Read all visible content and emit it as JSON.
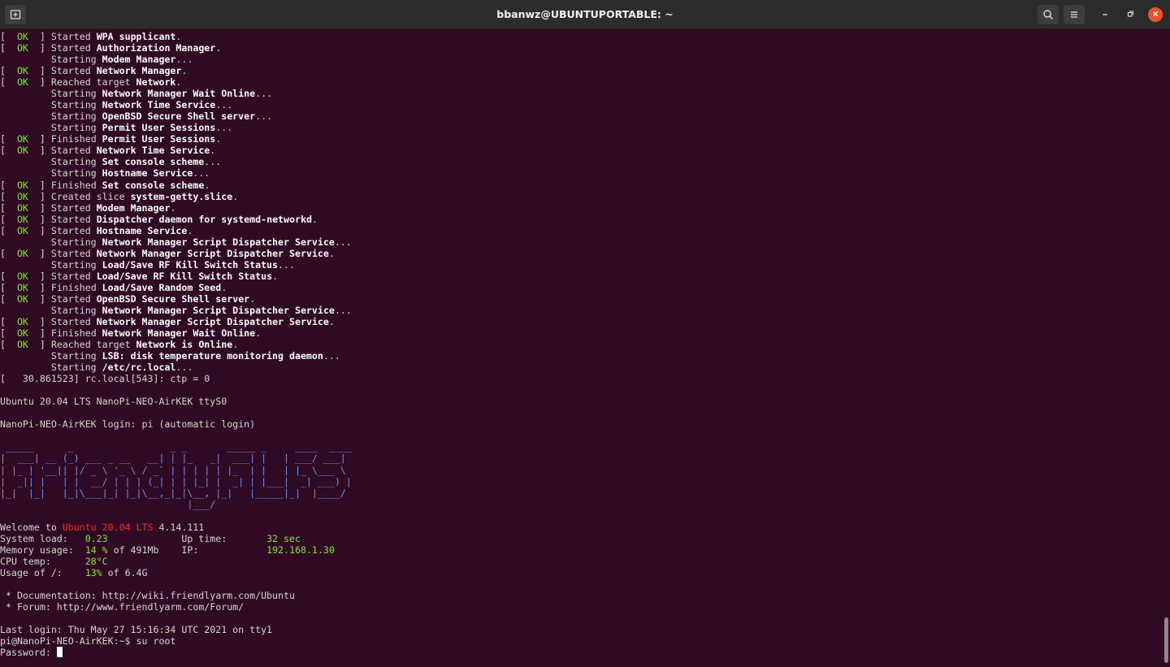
{
  "window": {
    "title": "bbanwz@UBUNTUPORTABLE: ~",
    "icons": {
      "new_tab": "new-tab-icon",
      "search": "search-icon",
      "menu": "hamburger-menu-icon",
      "minimize": "minimize-icon",
      "maximize": "maximize-icon",
      "close": "close-icon"
    },
    "colors": {
      "terminal_bg": "#300a24",
      "titlebar_bg": "#2c2c2c",
      "ok_green": "#8ae234",
      "highlight_red": "#ef2929",
      "logo_blue": "#7a8fe0",
      "close_orange": "#e9542b"
    }
  },
  "terminal": {
    "lines": [
      [
        {
          "t": "[  "
        },
        {
          "t": "OK",
          "c": "ok"
        },
        {
          "t": "  ] Started "
        },
        {
          "t": "WPA supplicant",
          "c": "b"
        },
        {
          "t": "."
        }
      ],
      [
        {
          "t": "[  "
        },
        {
          "t": "OK",
          "c": "ok"
        },
        {
          "t": "  ] Started "
        },
        {
          "t": "Authorization Manager",
          "c": "b"
        },
        {
          "t": "."
        }
      ],
      [
        {
          "t": "         Starting "
        },
        {
          "t": "Modem Manager",
          "c": "b"
        },
        {
          "t": "..."
        }
      ],
      [
        {
          "t": "[  "
        },
        {
          "t": "OK",
          "c": "ok"
        },
        {
          "t": "  ] Started "
        },
        {
          "t": "Network Manager",
          "c": "b"
        },
        {
          "t": "."
        }
      ],
      [
        {
          "t": "[  "
        },
        {
          "t": "OK",
          "c": "ok"
        },
        {
          "t": "  ] Reached target "
        },
        {
          "t": "Network",
          "c": "b"
        },
        {
          "t": "."
        }
      ],
      [
        {
          "t": "         Starting "
        },
        {
          "t": "Network Manager Wait Online",
          "c": "b"
        },
        {
          "t": "..."
        }
      ],
      [
        {
          "t": "         Starting "
        },
        {
          "t": "Network Time Service",
          "c": "b"
        },
        {
          "t": "..."
        }
      ],
      [
        {
          "t": "         Starting "
        },
        {
          "t": "OpenBSD Secure Shell server",
          "c": "b"
        },
        {
          "t": "..."
        }
      ],
      [
        {
          "t": "         Starting "
        },
        {
          "t": "Permit User Sessions",
          "c": "b"
        },
        {
          "t": "..."
        }
      ],
      [
        {
          "t": "[  "
        },
        {
          "t": "OK",
          "c": "ok"
        },
        {
          "t": "  ] Finished "
        },
        {
          "t": "Permit User Sessions",
          "c": "b"
        },
        {
          "t": "."
        }
      ],
      [
        {
          "t": "[  "
        },
        {
          "t": "OK",
          "c": "ok"
        },
        {
          "t": "  ] Started "
        },
        {
          "t": "Network Time Service",
          "c": "b"
        },
        {
          "t": "."
        }
      ],
      [
        {
          "t": "         Starting "
        },
        {
          "t": "Set console scheme",
          "c": "b"
        },
        {
          "t": "..."
        }
      ],
      [
        {
          "t": "         Starting "
        },
        {
          "t": "Hostname Service",
          "c": "b"
        },
        {
          "t": "..."
        }
      ],
      [
        {
          "t": "[  "
        },
        {
          "t": "OK",
          "c": "ok"
        },
        {
          "t": "  ] Finished "
        },
        {
          "t": "Set console scheme",
          "c": "b"
        },
        {
          "t": "."
        }
      ],
      [
        {
          "t": "[  "
        },
        {
          "t": "OK",
          "c": "ok"
        },
        {
          "t": "  ] Created slice "
        },
        {
          "t": "system-getty.slice",
          "c": "b"
        },
        {
          "t": "."
        }
      ],
      [
        {
          "t": "[  "
        },
        {
          "t": "OK",
          "c": "ok"
        },
        {
          "t": "  ] Started "
        },
        {
          "t": "Modem Manager",
          "c": "b"
        },
        {
          "t": "."
        }
      ],
      [
        {
          "t": "[  "
        },
        {
          "t": "OK",
          "c": "ok"
        },
        {
          "t": "  ] Started "
        },
        {
          "t": "Dispatcher daemon for systemd-networkd",
          "c": "b"
        },
        {
          "t": "."
        }
      ],
      [
        {
          "t": "[  "
        },
        {
          "t": "OK",
          "c": "ok"
        },
        {
          "t": "  ] Started "
        },
        {
          "t": "Hostname Service",
          "c": "b"
        },
        {
          "t": "."
        }
      ],
      [
        {
          "t": "         Starting "
        },
        {
          "t": "Network Manager Script Dispatcher Service",
          "c": "b"
        },
        {
          "t": "..."
        }
      ],
      [
        {
          "t": "[  "
        },
        {
          "t": "OK",
          "c": "ok"
        },
        {
          "t": "  ] Started "
        },
        {
          "t": "Network Manager Script Dispatcher Service",
          "c": "b"
        },
        {
          "t": "."
        }
      ],
      [
        {
          "t": "         Starting "
        },
        {
          "t": "Load/Save RF Kill Switch Status",
          "c": "b"
        },
        {
          "t": "..."
        }
      ],
      [
        {
          "t": "[  "
        },
        {
          "t": "OK",
          "c": "ok"
        },
        {
          "t": "  ] Started "
        },
        {
          "t": "Load/Save RF Kill Switch Status",
          "c": "b"
        },
        {
          "t": "."
        }
      ],
      [
        {
          "t": "[  "
        },
        {
          "t": "OK",
          "c": "ok"
        },
        {
          "t": "  ] Finished "
        },
        {
          "t": "Load/Save Random Seed",
          "c": "b"
        },
        {
          "t": "."
        }
      ],
      [
        {
          "t": "[  "
        },
        {
          "t": "OK",
          "c": "ok"
        },
        {
          "t": "  ] Started "
        },
        {
          "t": "OpenBSD Secure Shell server",
          "c": "b"
        },
        {
          "t": "."
        }
      ],
      [
        {
          "t": "         Starting "
        },
        {
          "t": "Network Manager Script Dispatcher Service",
          "c": "b"
        },
        {
          "t": "..."
        }
      ],
      [
        {
          "t": "[  "
        },
        {
          "t": "OK",
          "c": "ok"
        },
        {
          "t": "  ] Started "
        },
        {
          "t": "Network Manager Script Dispatcher Service",
          "c": "b"
        },
        {
          "t": "."
        }
      ],
      [
        {
          "t": "[  "
        },
        {
          "t": "OK",
          "c": "ok"
        },
        {
          "t": "  ] Finished "
        },
        {
          "t": "Network Manager Wait Online",
          "c": "b"
        },
        {
          "t": "."
        }
      ],
      [
        {
          "t": "[  "
        },
        {
          "t": "OK",
          "c": "ok"
        },
        {
          "t": "  ] Reached target "
        },
        {
          "t": "Network is Online",
          "c": "b"
        },
        {
          "t": "."
        }
      ],
      [
        {
          "t": "         Starting "
        },
        {
          "t": "LSB: disk temperature monitoring daemon",
          "c": "b"
        },
        {
          "t": "..."
        }
      ],
      [
        {
          "t": "         Starting "
        },
        {
          "t": "/etc/rc.local",
          "c": "b"
        },
        {
          "t": "..."
        }
      ],
      [
        {
          "t": "[   30.861523] rc.local[543]: ctp = 0"
        }
      ],
      [],
      [
        {
          "t": "Ubuntu 20.04 LTS NanoPi-NEO-AirKEK ttyS0"
        }
      ],
      [],
      [
        {
          "t": "NanoPi-NEO-AirKEK login: pi (automatic login)"
        }
      ],
      [],
      [
        {
          "t": " _____      _                 _ _       _____ _     ____  ____ ",
          "c": "logo"
        }
      ],
      [
        {
          "t": "|  ___| __ (_) ___ _ __   __| | |_   _|  ___| |   | ___/ ___|",
          "c": "logo"
        }
      ],
      [
        {
          "t": "| |_ | '__|| |/ _ \\ '_ \\ / _` | | | | | |_  | |   | |_ \\___ \\",
          "c": "logo"
        }
      ],
      [
        {
          "t": "|  _|| |   | |  __/ | | | (_| | | |_| |  _| | |___|  _| ___) |",
          "c": "logo"
        }
      ],
      [
        {
          "t": "|_|  |_|   |_|\\___|_| |_|\\__,_|_|\\__, |_|   |_____|_|  |____/",
          "c": "logo"
        }
      ],
      [
        {
          "t": "                                 |___/",
          "c": "logo"
        }
      ],
      [],
      [
        {
          "t": "Welcome to "
        },
        {
          "t": "Ubuntu 20.04 LTS",
          "c": "red"
        },
        {
          "t": " 4.14.111"
        }
      ],
      [
        {
          "t": "System load:   "
        },
        {
          "t": "0.23",
          "c": "grn"
        },
        {
          "t": "             Up time:       "
        },
        {
          "t": "32 sec",
          "c": "grn"
        }
      ],
      [
        {
          "t": "Memory usage:  "
        },
        {
          "t": "14 %",
          "c": "grn"
        },
        {
          "t": " of 491Mb    IP:            "
        },
        {
          "t": "192.168.1.30",
          "c": "grn"
        }
      ],
      [
        {
          "t": "CPU temp:      "
        },
        {
          "t": "28°C",
          "c": "grn"
        }
      ],
      [
        {
          "t": "Usage of /:    "
        },
        {
          "t": "13%",
          "c": "grn"
        },
        {
          "t": " of 6.4G"
        }
      ],
      [],
      [
        {
          "t": " * Documentation: http://wiki.friendlyarm.com/Ubuntu"
        }
      ],
      [
        {
          "t": " * Forum: http://www.friendlyarm.com/Forum/"
        }
      ],
      [],
      [
        {
          "t": "Last login: Thu May 27 15:16:34 UTC 2021 on tty1"
        }
      ],
      [
        {
          "t": "pi@NanoPi-NEO-AirKEK:~$ su root"
        }
      ],
      [
        {
          "t": "Password: "
        }
      ]
    ]
  }
}
